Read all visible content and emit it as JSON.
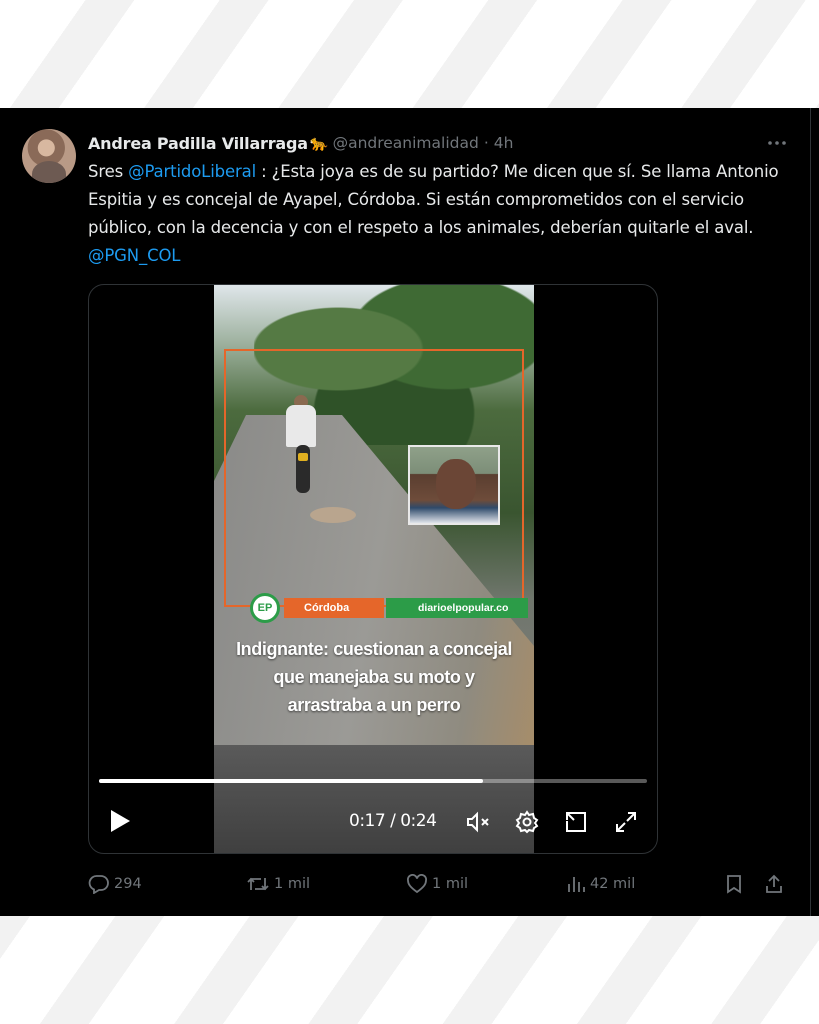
{
  "tweet": {
    "author": {
      "display_name": "Andrea Padilla Villarraga",
      "emoji": "🐆",
      "handle": "@andreanimalidad",
      "separator": "·",
      "time": "4h"
    },
    "text": {
      "part1": "Sres ",
      "mention1": "@PartidoLiberal",
      "part2": " : ¿Esta joya es de su partido? Me dicen que sí. Se llama Antonio Espitia y es concejal de Ayapel, Córdoba. Si están comprometidos con el servicio público, con la decencia y con el respeto a los animales, deberían quitarle el aval. ",
      "mention2": "@PGN_COL"
    },
    "media": {
      "overlay_logo": "EP",
      "overlay_region": "Córdoba",
      "overlay_site": "diarioelpopular.co",
      "headline_lines": [
        "Indignante: cuestionan a concejal",
        "que manejaba su moto y",
        "arrastraba a un perro"
      ],
      "time_readout": "0:17 / 0:24",
      "progress": 0.7
    },
    "actions": {
      "replies": "294",
      "reposts": "1 mil",
      "likes": "1 mil",
      "views": "42 mil"
    }
  },
  "colors": {
    "background": "#000000",
    "text": "#e7e9ea",
    "muted": "#71767b",
    "link": "#1d9bf0",
    "overlay_orange": "#e5662a",
    "overlay_green": "#2c9c48"
  },
  "icons": {
    "more": "more-icon",
    "play": "play-icon",
    "mute": "mute-icon",
    "settings": "gear-icon",
    "pip": "pip-icon",
    "fullscreen": "fullscreen-icon",
    "reply": "reply-icon",
    "repost": "repost-icon",
    "like": "heart-icon",
    "views": "views-icon",
    "bookmark": "bookmark-icon",
    "share": "share-icon"
  }
}
